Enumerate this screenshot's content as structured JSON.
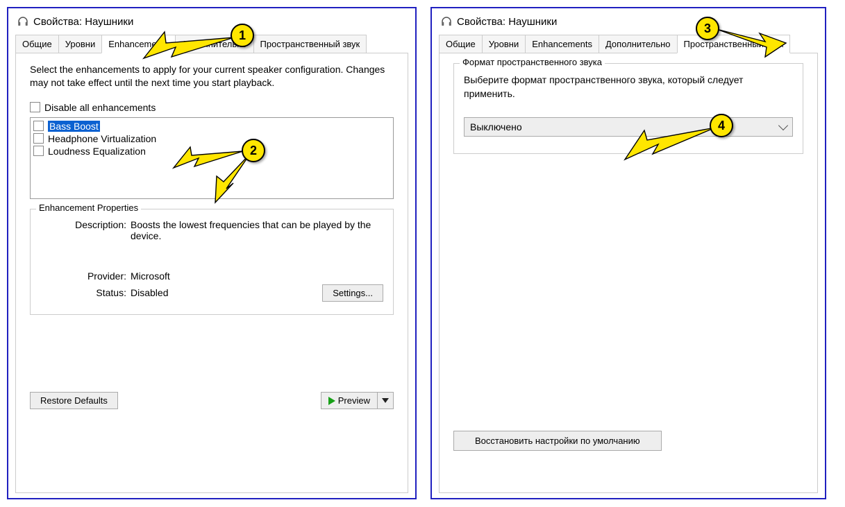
{
  "left": {
    "title": "Свойства: Наушники",
    "tabs": [
      "Общие",
      "Уровни",
      "Enhancements",
      "Дополнительно",
      "Пространственный звук"
    ],
    "active_tab_index": 2,
    "intro": "Select the enhancements to apply for your current speaker configuration. Changes may not take effect until the next time you start playback.",
    "disable_all_label": "Disable all enhancements",
    "enhancements": [
      {
        "label": "Bass Boost",
        "selected": true
      },
      {
        "label": "Headphone Virtualization",
        "selected": false
      },
      {
        "label": "Loudness Equalization",
        "selected": false
      }
    ],
    "properties": {
      "legend": "Enhancement Properties",
      "description_label": "Description:",
      "description_value": "Boosts the lowest frequencies that can be played by the device.",
      "provider_label": "Provider:",
      "provider_value": "Microsoft",
      "status_label": "Status:",
      "status_value": "Disabled",
      "settings_button": "Settings..."
    },
    "restore_button": "Restore Defaults",
    "preview_button": "Preview"
  },
  "right": {
    "title": "Свойства: Наушники",
    "tabs": [
      "Общие",
      "Уровни",
      "Enhancements",
      "Дополнительно",
      "Пространственный звук"
    ],
    "active_tab_index": 4,
    "group_legend": "Формат пространственного звука",
    "group_text": "Выберите формат пространственного звука, который следует применить.",
    "combo_value": "Выключено",
    "restore_button": "Восстановить настройки по умолчанию"
  },
  "callouts": {
    "c1": "1",
    "c2": "2",
    "c3": "3",
    "c4": "4"
  }
}
